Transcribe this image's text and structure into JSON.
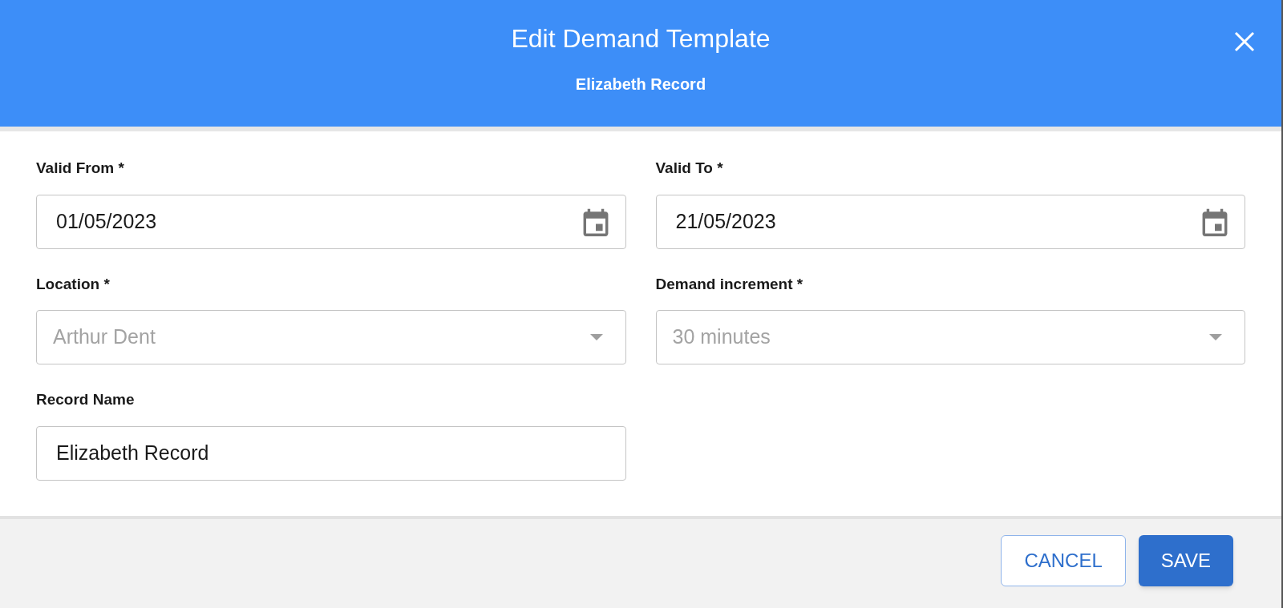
{
  "dialog": {
    "title": "Edit Demand Template",
    "subtitle": "Elizabeth Record"
  },
  "fields": [
    {
      "label": "Valid From *",
      "kind": "date",
      "value": "01/05/2023",
      "disabled": false
    },
    {
      "label": "Valid To *",
      "kind": "date",
      "value": "21/05/2023",
      "disabled": false
    },
    {
      "label": "Location *",
      "kind": "select",
      "value": "Arthur Dent",
      "disabled": true
    },
    {
      "label": "Demand increment *",
      "kind": "select",
      "value": "30 minutes",
      "disabled": true
    },
    {
      "label": "Record Name",
      "kind": "text",
      "value": "Elizabeth Record",
      "disabled": false
    }
  ],
  "buttons": [
    {
      "label": "CANCEL",
      "kind": "outlined"
    },
    {
      "label": "SAVE",
      "kind": "contained"
    }
  ]
}
